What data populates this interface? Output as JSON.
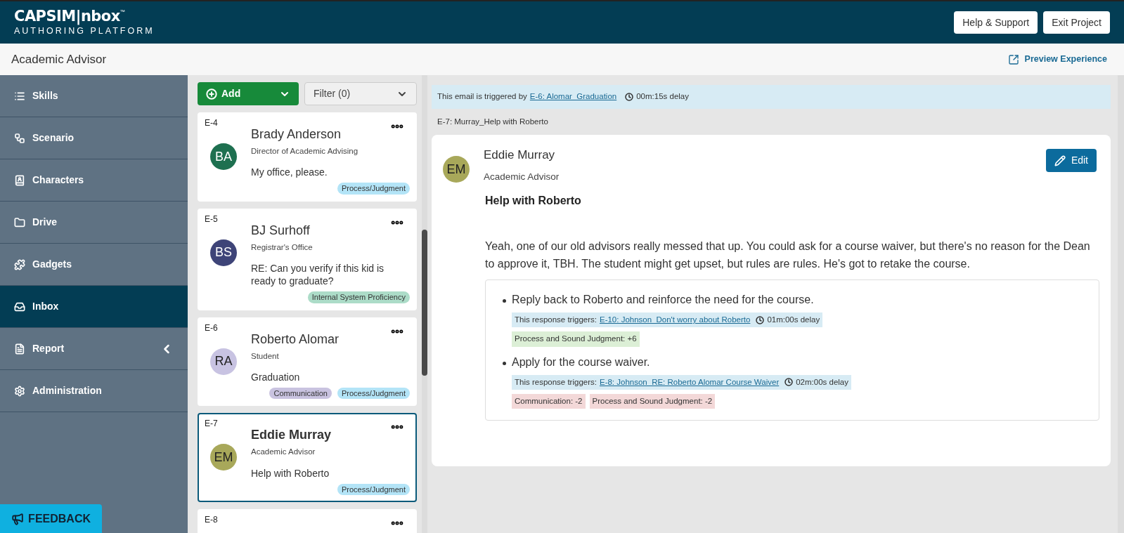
{
  "header": {
    "logo": "CAPSIM|nbox",
    "logo_tm": "™",
    "logo_subtitle": "AUTHORING PLATFORM",
    "buttons": [
      "Help & Support",
      "Exit Project"
    ]
  },
  "subheader": {
    "title": "Academic Advisor",
    "preview_link": "Preview Experience"
  },
  "sidebar": {
    "items": [
      {
        "label": "Skills",
        "selected": false,
        "has_submenu": false
      },
      {
        "label": "Scenario",
        "selected": false,
        "has_submenu": false
      },
      {
        "label": "Characters",
        "selected": false,
        "has_submenu": false
      },
      {
        "label": "Drive",
        "selected": false,
        "has_submenu": false
      },
      {
        "label": "Gadgets",
        "selected": false,
        "has_submenu": false
      },
      {
        "label": "Inbox",
        "selected": true,
        "has_submenu": false
      },
      {
        "label": "Report",
        "selected": false,
        "has_submenu": true
      },
      {
        "label": "Administration",
        "selected": false,
        "has_submenu": false
      }
    ],
    "feedback": "FEEDBACK"
  },
  "email_list": {
    "add_button": "Add",
    "filter_button": "Filter (0)",
    "items": [
      {
        "id": "E-4",
        "initials": "BA",
        "color": "#1e7050",
        "name": "Brady Anderson",
        "role": "Director of Academic Advising",
        "subject": "My office, please.",
        "selected": false,
        "tags": [
          {
            "label": "Process/Judgment",
            "color": "#b3e4f7"
          }
        ]
      },
      {
        "id": "E-5",
        "initials": "BS",
        "color": "#3e4478",
        "name": "BJ Surhoff",
        "role": "Registrar's Office",
        "subject": "RE: Can you verify if this kid is ready to graduate?",
        "selected": false,
        "tags": [
          {
            "label": "Internal System Proficiency",
            "color": "#acdcc8"
          }
        ]
      },
      {
        "id": "E-6",
        "initials": "RA",
        "color": "#c8c3e2",
        "name": "Roberto Alomar",
        "role": "Student",
        "subject": "Graduation",
        "selected": false,
        "tags": [
          {
            "label": "Communication",
            "color": "#c9c3e0"
          },
          {
            "label": "Process/Judgment",
            "color": "#b3e4f7"
          }
        ]
      },
      {
        "id": "E-7",
        "initials": "EM",
        "color": "#a8a85a",
        "name": "Eddie Murray",
        "role": "Academic Advisor",
        "subject": "Help with Roberto",
        "selected": true,
        "tags": [
          {
            "label": "Process/Judgment",
            "color": "#b3e4f7"
          }
        ]
      },
      {
        "id": "E-8",
        "selected": false
      }
    ]
  },
  "detail": {
    "trigger": {
      "prefix": "This email is triggered by",
      "link": "E-6: Alomar_Graduation",
      "delay": "00m:15s delay"
    },
    "email_title": "E-7: Murray_Help with Roberto",
    "sender": {
      "initials": "EM",
      "color": "#a8a85a",
      "name": "Eddie Murray",
      "role": "Academic Advisor"
    },
    "edit_button": "Edit",
    "subject": "Help with Roberto",
    "body": "Yeah, one of our old advisors really messed that up. You could ask for a course waiver, but there's no reason for the Dean to approve it, TBH. The student might get upset, but rules are rules. He's got to retake the course.",
    "responses": [
      {
        "text": "Reply back to Roberto and reinforce the need for the course.",
        "trigger_prefix": "This response triggers:",
        "trigger_link": "E-10: Johnson_Don't worry about Roberto",
        "delay": "01m:00s delay",
        "scores": [
          {
            "label": "Process and Sound Judgment: +6",
            "color": "#dcefd6"
          }
        ]
      },
      {
        "text": "Apply for the course waiver.",
        "trigger_prefix": "This response triggers:",
        "trigger_link": "E-8: Johnson_RE: Roberto Alomar Course Waiver",
        "delay": "02m:00s delay",
        "scores": [
          {
            "label": "Communication: -2",
            "color": "#f3d8d8"
          },
          {
            "label": "Process and Sound Judgment: -2",
            "color": "#f3d8d8"
          }
        ]
      }
    ]
  }
}
